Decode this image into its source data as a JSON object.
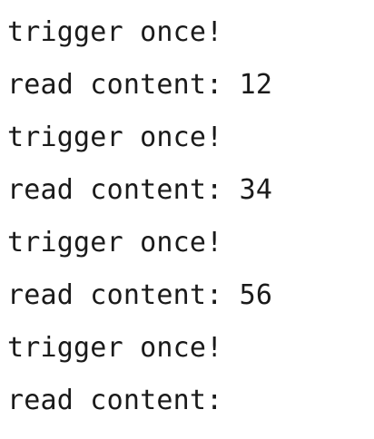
{
  "console": {
    "lines": [
      "trigger once!",
      "read content: 12",
      "trigger once!",
      "read content: 34",
      "trigger once!",
      "read content: 56",
      "trigger once!",
      "read content:"
    ]
  },
  "colors": {
    "background": "#ffffff",
    "text": "#1a1a1a"
  }
}
